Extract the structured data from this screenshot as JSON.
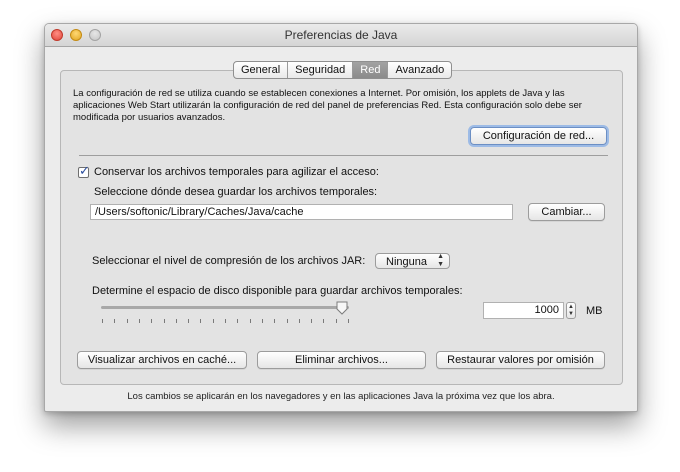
{
  "window": {
    "title": "Preferencias de Java"
  },
  "tabs": [
    {
      "label": "General",
      "active": false
    },
    {
      "label": "Seguridad",
      "active": false
    },
    {
      "label": "Red",
      "active": true
    },
    {
      "label": "Avanzado",
      "active": false
    }
  ],
  "network": {
    "description": "La configuración de red se utiliza cuando se establecen conexiones a Internet. Por omisión, los applets de Java y las aplicaciones Web Start utilizarán la configuración de red del panel de preferencias Red. Esta configuración solo debe ser modificada por usuarios avanzados.",
    "settings_button": "Configuración de red..."
  },
  "temp_files": {
    "keep_checked": true,
    "keep_label": "Conservar los archivos temporales para agilizar el acceso:",
    "location_label": "Seleccione dónde desea guardar los archivos temporales:",
    "path_value": "/Users/softonic/Library/Caches/Java/cache",
    "change_button": "Cambiar...",
    "compression_label": "Seleccionar el nivel de compresión de los archivos JAR:",
    "compression_value": "Ninguna",
    "disk_space_label": "Determine el espacio de disco disponible para guardar archivos temporales:",
    "disk_space_value": "1000",
    "disk_space_unit": "MB",
    "slider_level": 1.0,
    "view_button": "Visualizar archivos en caché...",
    "delete_button": "Eliminar archivos...",
    "restore_button": "Restaurar valores por omisión"
  },
  "footer": {
    "text": "Los cambios se aplicarán en los navegadores y en las aplicaciones Java la próxima vez que los abra."
  },
  "colors": {
    "accent": "#2b4e9e",
    "selected_tab": "#959595"
  }
}
